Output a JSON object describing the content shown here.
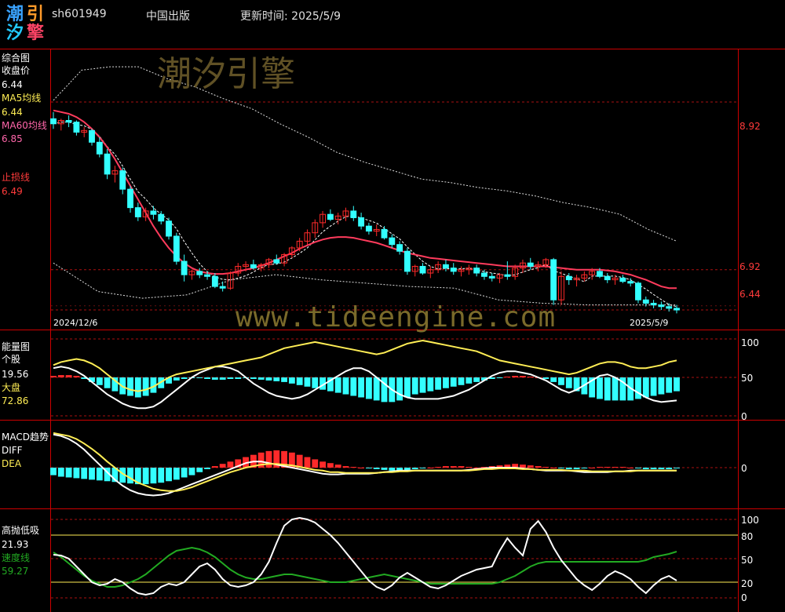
{
  "header": {
    "logo_chars": [
      "潮",
      "引",
      "汐",
      "擎"
    ],
    "code": "sh601949",
    "name": "中国出版",
    "update_label": "更新时间: 2025/5/9"
  },
  "watermark": {
    "cn": "潮汐引擎",
    "url": "www.tideengine.com"
  },
  "colors": {
    "up": "#ff2a2a",
    "down": "#33ffff",
    "ma5": "#ffffff",
    "ma60": "#ff3b5c",
    "stop": "#ff3b3b",
    "yellow": "#ffee55",
    "green": "#22aa22"
  },
  "panel_main": {
    "title": "综合图",
    "close_label": "收盘价",
    "close_value": "6.44",
    "ma5_label": "MA5均线",
    "ma5_value": "6.44",
    "ma60_label": "MA60均线",
    "ma60_value": "6.85",
    "stop_label": "止损线",
    "stop_value": "6.49",
    "date_start": "2024/12/6",
    "date_end": "2025/5/9",
    "right_ticks": [
      "8.92",
      "6.92",
      "6.44"
    ]
  },
  "panel_energy": {
    "title": "能量图",
    "stock_label": "个股",
    "stock_value": "19.56",
    "market_label": "大盘",
    "market_value": "72.86",
    "ticks": [
      "100",
      "50",
      "0"
    ]
  },
  "panel_macd": {
    "title": "MACD趋势",
    "diff_label": "DIFF",
    "dea_label": "DEA",
    "ticks": [
      "0"
    ]
  },
  "panel_osc": {
    "title": "高抛低吸",
    "value1": "21.93",
    "speed_label": "速度线",
    "speed_value": "59.27",
    "ticks": [
      "100",
      "80",
      "50",
      "20",
      "0"
    ]
  },
  "chart_data": {
    "type": "candlestick-with-indicators",
    "x_range": [
      "2024/12/6",
      "2025/5/9"
    ],
    "candles_ohlc": [
      [
        8.72,
        8.8,
        8.6,
        8.66
      ],
      [
        8.66,
        8.72,
        8.58,
        8.7
      ],
      [
        8.7,
        8.76,
        8.62,
        8.68
      ],
      [
        8.68,
        8.7,
        8.52,
        8.56
      ],
      [
        8.56,
        8.62,
        8.5,
        8.58
      ],
      [
        8.58,
        8.6,
        8.4,
        8.44
      ],
      [
        8.44,
        8.5,
        8.26,
        8.3
      ],
      [
        8.3,
        8.36,
        8.0,
        8.06
      ],
      [
        8.06,
        8.16,
        7.96,
        8.1
      ],
      [
        8.1,
        8.14,
        7.82,
        7.88
      ],
      [
        7.88,
        7.92,
        7.6,
        7.66
      ],
      [
        7.66,
        7.72,
        7.5,
        7.55
      ],
      [
        7.55,
        7.66,
        7.5,
        7.62
      ],
      [
        7.62,
        7.68,
        7.52,
        7.58
      ],
      [
        7.58,
        7.62,
        7.46,
        7.5
      ],
      [
        7.5,
        7.54,
        7.28,
        7.32
      ],
      [
        7.32,
        7.36,
        6.98,
        7.02
      ],
      [
        7.02,
        7.1,
        6.78,
        6.86
      ],
      [
        6.86,
        6.92,
        6.8,
        6.9
      ],
      [
        6.9,
        6.94,
        6.82,
        6.86
      ],
      [
        6.86,
        6.9,
        6.8,
        6.84
      ],
      [
        6.84,
        6.88,
        6.7,
        6.72
      ],
      [
        6.72,
        6.78,
        6.66,
        6.7
      ],
      [
        6.7,
        6.9,
        6.68,
        6.88
      ],
      [
        6.88,
        7.0,
        6.84,
        6.96
      ],
      [
        6.96,
        7.02,
        6.9,
        6.98
      ],
      [
        6.98,
        7.04,
        6.92,
        6.94
      ],
      [
        6.94,
        7.0,
        6.9,
        6.98
      ],
      [
        6.98,
        7.06,
        6.94,
        7.04
      ],
      [
        7.04,
        7.1,
        6.98,
        7.0
      ],
      [
        7.0,
        7.12,
        6.96,
        7.1
      ],
      [
        7.1,
        7.2,
        7.06,
        7.18
      ],
      [
        7.18,
        7.3,
        7.14,
        7.26
      ],
      [
        7.26,
        7.4,
        7.22,
        7.36
      ],
      [
        7.36,
        7.52,
        7.3,
        7.48
      ],
      [
        7.48,
        7.62,
        7.42,
        7.58
      ],
      [
        7.58,
        7.64,
        7.5,
        7.52
      ],
      [
        7.52,
        7.6,
        7.46,
        7.56
      ],
      [
        7.56,
        7.66,
        7.5,
        7.62
      ],
      [
        7.62,
        7.68,
        7.5,
        7.54
      ],
      [
        7.54,
        7.6,
        7.4,
        7.44
      ],
      [
        7.44,
        7.48,
        7.34,
        7.38
      ],
      [
        7.38,
        7.46,
        7.32,
        7.4
      ],
      [
        7.4,
        7.44,
        7.28,
        7.3
      ],
      [
        7.3,
        7.34,
        7.18,
        7.22
      ],
      [
        7.22,
        7.26,
        7.1,
        7.14
      ],
      [
        7.14,
        7.18,
        6.86,
        6.9
      ],
      [
        6.9,
        6.98,
        6.84,
        6.96
      ],
      [
        6.96,
        7.0,
        6.86,
        6.88
      ],
      [
        6.88,
        6.96,
        6.82,
        6.92
      ],
      [
        6.92,
        7.02,
        6.88,
        6.98
      ],
      [
        6.98,
        7.04,
        6.9,
        6.94
      ],
      [
        6.94,
        7.0,
        6.86,
        6.9
      ],
      [
        6.9,
        6.96,
        6.84,
        6.92
      ],
      [
        6.92,
        6.98,
        6.86,
        6.94
      ],
      [
        6.94,
        6.98,
        6.84,
        6.88
      ],
      [
        6.88,
        6.92,
        6.8,
        6.84
      ],
      [
        6.84,
        6.88,
        6.78,
        6.82
      ],
      [
        6.82,
        6.88,
        6.76,
        6.86
      ],
      [
        6.86,
        7.02,
        6.8,
        6.84
      ],
      [
        6.84,
        6.98,
        6.8,
        6.94
      ],
      [
        6.94,
        7.04,
        6.88,
        7.0
      ],
      [
        7.0,
        7.06,
        6.92,
        6.96
      ],
      [
        6.96,
        7.02,
        6.9,
        6.98
      ],
      [
        6.98,
        7.06,
        6.94,
        7.04
      ],
      [
        7.04,
        7.06,
        6.5,
        6.56
      ],
      [
        6.56,
        6.9,
        6.5,
        6.84
      ],
      [
        6.84,
        6.88,
        6.74,
        6.8
      ],
      [
        6.8,
        6.86,
        6.72,
        6.82
      ],
      [
        6.82,
        6.9,
        6.78,
        6.86
      ],
      [
        6.86,
        6.94,
        6.8,
        6.9
      ],
      [
        6.9,
        6.94,
        6.82,
        6.84
      ],
      [
        6.84,
        6.88,
        6.76,
        6.8
      ],
      [
        6.8,
        6.86,
        6.74,
        6.82
      ],
      [
        6.82,
        6.86,
        6.76,
        6.78
      ],
      [
        6.78,
        6.82,
        6.72,
        6.76
      ],
      [
        6.76,
        6.78,
        6.52,
        6.56
      ],
      [
        6.56,
        6.6,
        6.48,
        6.52
      ],
      [
        6.52,
        6.56,
        6.46,
        6.5
      ],
      [
        6.5,
        6.54,
        6.44,
        6.48
      ],
      [
        6.48,
        6.52,
        6.42,
        6.46
      ],
      [
        6.46,
        6.5,
        6.4,
        6.44
      ]
    ],
    "ma60": [
      8.82,
      8.8,
      8.78,
      8.74,
      8.68,
      8.6,
      8.5,
      8.38,
      8.24,
      8.08,
      7.92,
      7.76,
      7.6,
      7.44,
      7.3,
      7.18,
      7.08,
      7.0,
      6.94,
      6.9,
      6.88,
      6.87,
      6.87,
      6.88,
      6.9,
      6.92,
      6.94,
      6.97,
      7.0,
      7.04,
      7.08,
      7.12,
      7.17,
      7.21,
      7.25,
      7.28,
      7.3,
      7.31,
      7.31,
      7.3,
      7.28,
      7.26,
      7.24,
      7.21,
      7.18,
      7.15,
      7.12,
      7.1,
      7.08,
      7.06,
      7.05,
      7.04,
      7.03,
      7.02,
      7.01,
      7.0,
      6.99,
      6.98,
      6.97,
      6.96,
      6.96,
      6.96,
      6.96,
      6.96,
      6.96,
      6.95,
      6.94,
      6.93,
      6.92,
      6.92,
      6.92,
      6.92,
      6.91,
      6.9,
      6.88,
      6.86,
      6.83,
      6.8,
      6.76,
      6.72,
      6.7,
      6.7
    ],
    "upper_band": [
      8.94,
      9.3,
      9.34,
      9.34,
      9.2,
      9.1,
      8.96,
      8.84,
      8.66,
      8.5,
      8.32,
      8.2,
      8.1,
      8.0,
      7.96,
      7.9,
      7.86,
      7.8,
      7.72,
      7.66,
      7.58,
      7.4,
      7.26
    ],
    "lower_band": [
      7.0,
      6.66,
      6.58,
      6.62,
      6.8,
      6.86,
      6.8,
      6.76,
      6.72,
      6.7,
      6.56,
      6.52,
      6.5,
      6.5,
      6.5
    ],
    "stop_line": 6.49,
    "levels": [
      8.92,
      6.92,
      6.44
    ],
    "energy": {
      "range": [
        0,
        100
      ],
      "stock_value": 19.56,
      "market_value": 72.86,
      "white_line": [
        62,
        64,
        62,
        58,
        52,
        44,
        36,
        28,
        22,
        16,
        12,
        10,
        10,
        12,
        18,
        26,
        34,
        42,
        50,
        56,
        60,
        64,
        64,
        62,
        58,
        50,
        42,
        36,
        30,
        26,
        24,
        22,
        24,
        28,
        34,
        40,
        46,
        52,
        58,
        62,
        62,
        58,
        50,
        42,
        34,
        28,
        24,
        22,
        22,
        22,
        22,
        24,
        26,
        30,
        34,
        40,
        46,
        52,
        56,
        58,
        58,
        56,
        54,
        50,
        46,
        40,
        34,
        30,
        34,
        40,
        46,
        52,
        54,
        50,
        44,
        36,
        30,
        24,
        20,
        18,
        19,
        20
      ],
      "yellow_line": [
        66,
        70,
        72,
        74,
        72,
        68,
        62,
        54,
        46,
        38,
        34,
        32,
        34,
        38,
        44,
        50,
        54,
        56,
        58,
        60,
        62,
        64,
        66,
        68,
        70,
        72,
        74,
        76,
        80,
        84,
        88,
        90,
        92,
        94,
        96,
        94,
        92,
        90,
        88,
        86,
        84,
        82,
        80,
        82,
        86,
        90,
        94,
        96,
        98,
        96,
        94,
        92,
        90,
        88,
        86,
        84,
        80,
        76,
        72,
        70,
        68,
        66,
        64,
        62,
        60,
        58,
        56,
        54,
        56,
        60,
        64,
        68,
        70,
        70,
        68,
        64,
        62,
        62,
        64,
        66,
        70,
        72
      ],
      "bars": [
        2,
        3,
        3,
        2,
        -2,
        -6,
        -10,
        -14,
        -18,
        -22,
        -24,
        -26,
        -24,
        -20,
        -14,
        -8,
        -4,
        -2,
        -1,
        -1,
        -2,
        -3,
        -3,
        -2,
        -2,
        -1,
        -2,
        -3,
        -4,
        -5,
        -6,
        -8,
        -10,
        -12,
        -14,
        -16,
        -18,
        -20,
        -22,
        -24,
        -26,
        -28,
        -30,
        -32,
        -32,
        -30,
        -26,
        -22,
        -20,
        -18,
        -16,
        -14,
        -12,
        -10,
        -8,
        -6,
        -4,
        -2,
        -1,
        1,
        2,
        2,
        1,
        0,
        -2,
        -6,
        -10,
        -14,
        -18,
        -22,
        -26,
        -28,
        -30,
        -30,
        -30,
        -30,
        -28,
        -26,
        -24,
        -22,
        -20,
        -18
      ]
    },
    "macd": {
      "histogram": [
        -0.1,
        -0.12,
        -0.13,
        -0.14,
        -0.15,
        -0.16,
        -0.17,
        -0.18,
        -0.19,
        -0.2,
        -0.21,
        -0.22,
        -0.22,
        -0.21,
        -0.2,
        -0.18,
        -0.16,
        -0.13,
        -0.1,
        -0.06,
        -0.02,
        0.02,
        0.05,
        0.08,
        0.11,
        0.14,
        0.17,
        0.2,
        0.22,
        0.23,
        0.22,
        0.2,
        0.17,
        0.14,
        0.11,
        0.08,
        0.06,
        0.04,
        0.02,
        0.01,
        0.0,
        -0.01,
        -0.02,
        -0.03,
        -0.04,
        -0.04,
        -0.03,
        -0.02,
        -0.01,
        0.0,
        0.01,
        0.02,
        0.02,
        0.02,
        0.01,
        0.0,
        0.01,
        0.02,
        0.03,
        0.04,
        0.05,
        0.04,
        0.03,
        0.02,
        0.01,
        0.0,
        -0.01,
        -0.02,
        -0.02,
        -0.01,
        0.0,
        0.01,
        0.01,
        0.01,
        0.01,
        0.0,
        -0.01,
        -0.02,
        -0.02,
        -0.02,
        -0.02,
        -0.01
      ],
      "diff": [
        0.44,
        0.42,
        0.38,
        0.32,
        0.24,
        0.14,
        0.04,
        -0.06,
        -0.16,
        -0.24,
        -0.3,
        -0.34,
        -0.36,
        -0.37,
        -0.36,
        -0.34,
        -0.3,
        -0.26,
        -0.22,
        -0.18,
        -0.14,
        -0.1,
        -0.06,
        -0.02,
        0.02,
        0.06,
        0.08,
        0.08,
        0.06,
        0.04,
        0.02,
        0.0,
        -0.02,
        -0.04,
        -0.06,
        -0.08,
        -0.09,
        -0.09,
        -0.08,
        -0.08,
        -0.08,
        -0.08,
        -0.07,
        -0.06,
        -0.05,
        -0.04,
        -0.04,
        -0.04,
        -0.04,
        -0.04,
        -0.04,
        -0.04,
        -0.04,
        -0.04,
        -0.03,
        -0.02,
        -0.01,
        0.0,
        0.0,
        0.0,
        0.0,
        -0.01,
        -0.02,
        -0.03,
        -0.04,
        -0.04,
        -0.04,
        -0.04,
        -0.05,
        -0.06,
        -0.06,
        -0.06,
        -0.06,
        -0.05,
        -0.05,
        -0.04,
        -0.04,
        -0.04,
        -0.04,
        -0.04,
        -0.04,
        -0.04
      ],
      "dea": [
        0.46,
        0.44,
        0.42,
        0.38,
        0.32,
        0.25,
        0.17,
        0.08,
        0.0,
        -0.08,
        -0.14,
        -0.2,
        -0.24,
        -0.28,
        -0.3,
        -0.31,
        -0.31,
        -0.29,
        -0.26,
        -0.22,
        -0.18,
        -0.14,
        -0.1,
        -0.06,
        -0.03,
        0.0,
        0.02,
        0.04,
        0.05,
        0.05,
        0.04,
        0.03,
        0.01,
        -0.01,
        -0.03,
        -0.04,
        -0.06,
        -0.06,
        -0.07,
        -0.07,
        -0.07,
        -0.07,
        -0.07,
        -0.06,
        -0.06,
        -0.05,
        -0.05,
        -0.04,
        -0.04,
        -0.04,
        -0.04,
        -0.04,
        -0.04,
        -0.04,
        -0.04,
        -0.03,
        -0.02,
        -0.02,
        -0.01,
        -0.01,
        -0.01,
        -0.02,
        -0.02,
        -0.03,
        -0.03,
        -0.03,
        -0.03,
        -0.04,
        -0.04,
        -0.04,
        -0.05,
        -0.05,
        -0.05,
        -0.05,
        -0.05,
        -0.05,
        -0.04,
        -0.04,
        -0.04,
        -0.04,
        -0.04,
        -0.04
      ]
    },
    "oscillator": {
      "range": [
        0,
        100
      ],
      "levels": [
        80,
        50,
        20
      ],
      "white_line": [
        55,
        54,
        50,
        40,
        30,
        20,
        16,
        18,
        24,
        20,
        12,
        6,
        4,
        6,
        14,
        18,
        16,
        20,
        30,
        40,
        44,
        36,
        24,
        16,
        14,
        16,
        20,
        30,
        46,
        70,
        92,
        100,
        102,
        100,
        96,
        88,
        80,
        70,
        58,
        46,
        34,
        22,
        14,
        10,
        16,
        26,
        32,
        26,
        20,
        14,
        12,
        16,
        22,
        28,
        32,
        36,
        38,
        40,
        60,
        76,
        64,
        54,
        88,
        98,
        84,
        64,
        48,
        36,
        24,
        16,
        10,
        18,
        28,
        34,
        30,
        24,
        14,
        6,
        16,
        24,
        28,
        22
      ],
      "green_line": [
        58,
        52,
        44,
        36,
        28,
        22,
        18,
        14,
        14,
        16,
        20,
        24,
        30,
        38,
        46,
        54,
        60,
        62,
        64,
        62,
        58,
        52,
        44,
        36,
        30,
        26,
        24,
        24,
        26,
        28,
        30,
        30,
        28,
        26,
        24,
        22,
        20,
        20,
        20,
        22,
        24,
        26,
        28,
        30,
        28,
        26,
        24,
        22,
        20,
        18,
        18,
        18,
        18,
        18,
        18,
        18,
        18,
        18,
        20,
        24,
        28,
        34,
        40,
        44,
        46,
        46,
        46,
        46,
        46,
        46,
        46,
        46,
        46,
        46,
        46,
        46,
        46,
        48,
        52,
        54,
        56,
        59
      ]
    }
  }
}
